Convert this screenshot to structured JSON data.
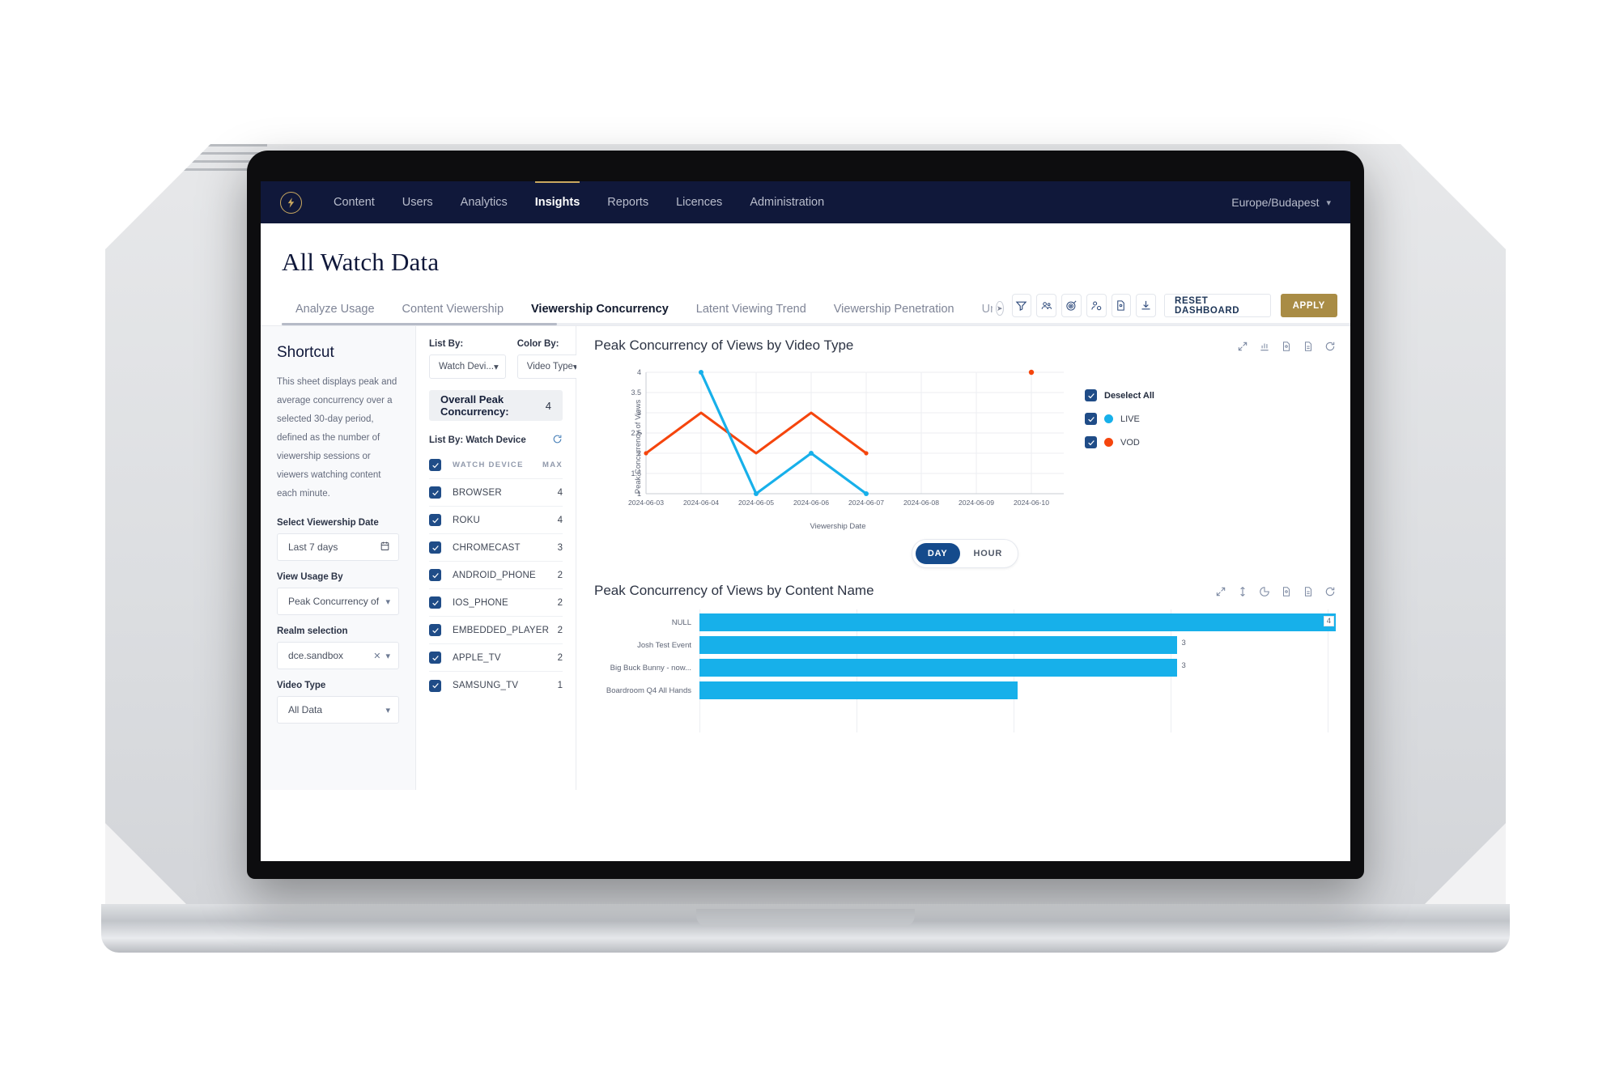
{
  "nav": {
    "logo_icon": "lightning-bolt-logo",
    "links": [
      "Content",
      "Users",
      "Analytics",
      "Insights",
      "Reports",
      "Licences",
      "Administration"
    ],
    "active_link": "Insights",
    "timezone": "Europe/Budapest"
  },
  "page": {
    "title": "All Watch Data"
  },
  "tabs": {
    "items": [
      "Analyze Usage",
      "Content Viewership",
      "Viewership Concurrency",
      "Latent Viewing Trend",
      "Viewership Penetration",
      "Unde"
    ],
    "active": "Viewership Concurrency",
    "overflow_icon": "chevron-right-circle-icon",
    "icons": [
      "filter-icon",
      "audience-icon",
      "target-icon",
      "user-settings-icon",
      "document-icon",
      "download-icon"
    ],
    "reset_label": "RESET DASHBOARD",
    "apply_label": "APPLY"
  },
  "shortcut": {
    "title": "Shortcut",
    "description": "This sheet displays peak and average concurrency over a selected 30-day period, defined as the number of viewership sessions or viewers watching content each minute.",
    "fields": [
      {
        "label": "Select Viewership Date",
        "value": "Last 7 days",
        "icon": "calendar-icon"
      },
      {
        "label": "View Usage By",
        "value": "Peak Concurrency of Views",
        "icon": "chevron-down-icon"
      },
      {
        "label": "Realm selection",
        "value": "dce.sandbox",
        "icon": "chevron-down-icon",
        "clear_icon": "close-icon"
      },
      {
        "label": "Video Type",
        "value": "All Data",
        "icon": "chevron-down-icon"
      }
    ]
  },
  "listpanel": {
    "list_by_label": "List By:",
    "list_by_value": "Watch Devi...",
    "color_by_label": "Color By:",
    "color_by_value": "Video Type",
    "overall_label": "Overall Peak Concurrency:",
    "overall_value": "4",
    "subtitle": "List By: Watch Device",
    "refresh_icon": "refresh-icon",
    "columns": [
      "WATCH DEVICE",
      "MAX"
    ],
    "rows": [
      {
        "name": "BROWSER",
        "max": "4",
        "checked": true
      },
      {
        "name": "ROKU",
        "max": "4",
        "checked": true
      },
      {
        "name": "CHROMECAST",
        "max": "3",
        "checked": true
      },
      {
        "name": "ANDROID_PHONE",
        "max": "2",
        "checked": true
      },
      {
        "name": "IOS_PHONE",
        "max": "2",
        "checked": true
      },
      {
        "name": "EMBEDDED_PLAYER",
        "max": "2",
        "checked": true
      },
      {
        "name": "APPLE_TV",
        "max": "2",
        "checked": true
      },
      {
        "name": "SAMSUNG_TV",
        "max": "1",
        "checked": true
      }
    ]
  },
  "line_chart_panel": {
    "title": "Peak Concurrency of Views by Video Type",
    "tools": [
      "expand-icon",
      "bar-chart-icon",
      "image-export-icon",
      "document-export-icon",
      "refresh-icon"
    ],
    "legend": {
      "deselect_label": "Deselect All",
      "items": [
        {
          "label": "LIVE",
          "color": "#17b0ea"
        },
        {
          "label": "VOD",
          "color": "#f5450d"
        }
      ]
    },
    "granularity": {
      "options": [
        "DAY",
        "HOUR"
      ],
      "selected": "DAY"
    }
  },
  "bar_chart_panel": {
    "title": "Peak Concurrency of Views by Content Name",
    "tools": [
      "expand-icon",
      "sort-icon",
      "pie-chart-icon",
      "image-export-icon",
      "document-export-icon",
      "refresh-icon"
    ]
  },
  "chart_data": [
    {
      "type": "line",
      "title": "Peak Concurrency of Views by Video Type",
      "xlabel": "Viewership Date",
      "ylabel": "Peak Concurrency of Views",
      "x": [
        "2024-06-03",
        "2024-06-04",
        "2024-06-05",
        "2024-06-06",
        "2024-06-07",
        "2024-06-08",
        "2024-06-09",
        "2024-06-10"
      ],
      "yticks": [
        1,
        1.5,
        2,
        2.5,
        3,
        3.5,
        4
      ],
      "ylim": [
        1,
        4
      ],
      "grid": true,
      "legend_position": "right",
      "series": [
        {
          "name": "LIVE",
          "color": "#17b0ea",
          "x": [
            "2024-06-04",
            "2024-06-05",
            "2024-06-06",
            "2024-06-07"
          ],
          "values": [
            4,
            1,
            2,
            1
          ]
        },
        {
          "name": "VOD",
          "color": "#f5450d",
          "x": [
            "2024-06-03",
            "2024-06-04",
            "2024-06-05",
            "2024-06-06",
            "2024-06-07",
            "2024-06-10"
          ],
          "values": [
            2,
            3,
            2,
            3,
            2,
            4
          ]
        }
      ]
    },
    {
      "type": "bar",
      "orientation": "horizontal",
      "title": "Peak Concurrency of Views by Content Name",
      "categories": [
        "NULL",
        "Josh Test Event",
        "Big Buck Bunny - now...",
        "Boardroom Q4 All Hands"
      ],
      "values": [
        4,
        3,
        3,
        2
      ],
      "labels": [
        "4",
        "3",
        "3",
        ""
      ],
      "color": "#17b0ea",
      "xlim": [
        0,
        4
      ],
      "grid": true
    }
  ]
}
